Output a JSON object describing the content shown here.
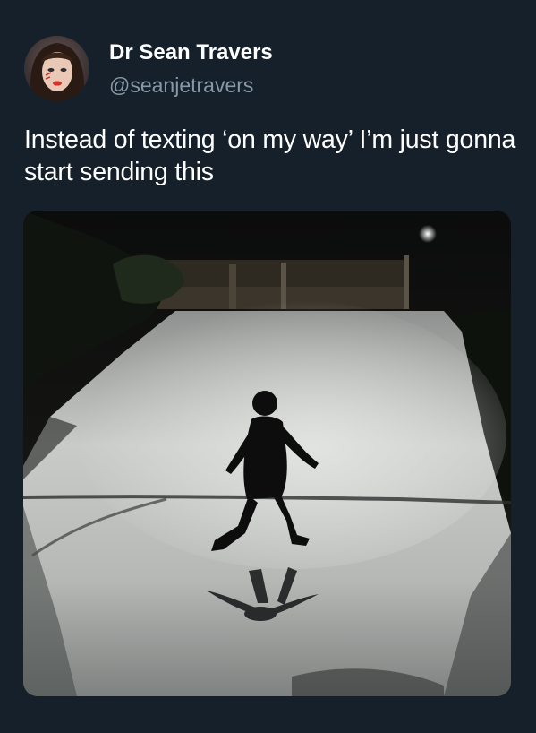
{
  "author": {
    "display_name": "Dr Sean Travers",
    "handle": "@seanjetravers"
  },
  "tweet": {
    "text": "Instead of texting ‘on my way’ I’m just gonna start sending this"
  },
  "colors": {
    "background": "#15202b",
    "primary_text": "#ffffff",
    "secondary_text": "#8899a6"
  },
  "icons": {
    "avatar": "profile-photo",
    "media": "photo-child-running-on-wet-road-at-night"
  }
}
